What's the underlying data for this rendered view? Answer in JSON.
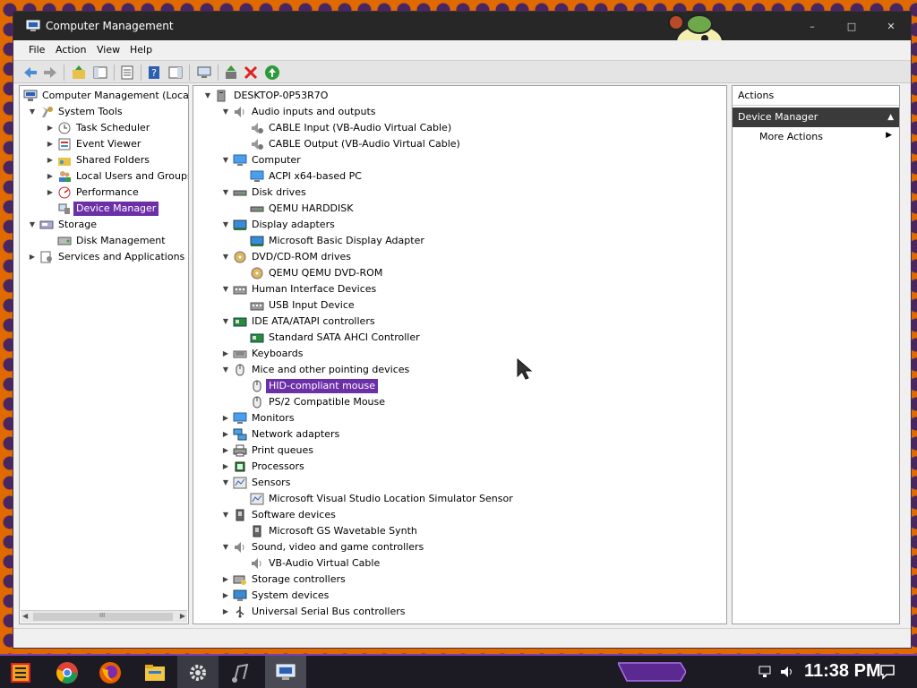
{
  "window": {
    "title": "Computer Management",
    "controls": {
      "minimize": "–",
      "maximize": "□",
      "close": "✕"
    }
  },
  "menu": [
    "File",
    "Action",
    "View",
    "Help"
  ],
  "left_tree": [
    {
      "label": "Computer Management (Local)",
      "icon": "computer-management-icon",
      "exp": ""
    },
    {
      "label": "System Tools",
      "icon": "system-tools-icon",
      "exp": "▼"
    },
    {
      "label": "Task Scheduler",
      "icon": "task-scheduler-icon",
      "exp": "▶"
    },
    {
      "label": "Event Viewer",
      "icon": "event-viewer-icon",
      "exp": "▶"
    },
    {
      "label": "Shared Folders",
      "icon": "shared-folders-icon",
      "exp": "▶"
    },
    {
      "label": "Local Users and Groups",
      "icon": "users-icon",
      "exp": "▶"
    },
    {
      "label": "Performance",
      "icon": "performance-icon",
      "exp": "▶"
    },
    {
      "label": "Device Manager",
      "icon": "device-manager-icon",
      "exp": "",
      "selected": true
    },
    {
      "label": "Storage",
      "icon": "storage-icon",
      "exp": "▼"
    },
    {
      "label": "Disk Management",
      "icon": "disk-management-icon",
      "exp": ""
    },
    {
      "label": "Services and Applications",
      "icon": "services-icon",
      "exp": "▶"
    }
  ],
  "device_tree": [
    {
      "label": "DESKTOP-0P53R7O",
      "icon": "computer-icon",
      "exp": "▼"
    },
    {
      "label": "Audio inputs and outputs",
      "icon": "speaker-icon",
      "exp": "▼"
    },
    {
      "label": "CABLE Input (VB-Audio Virtual Cable)",
      "icon": "audio-device-icon",
      "exp": ""
    },
    {
      "label": "CABLE Output (VB-Audio Virtual Cable)",
      "icon": "audio-device-icon",
      "exp": ""
    },
    {
      "label": "Computer",
      "icon": "monitor-icon",
      "exp": "▼"
    },
    {
      "label": "ACPI x64-based PC",
      "icon": "monitor-icon",
      "exp": ""
    },
    {
      "label": "Disk drives",
      "icon": "disk-icon",
      "exp": "▼"
    },
    {
      "label": "QEMU HARDDISK",
      "icon": "disk-icon",
      "exp": ""
    },
    {
      "label": "Display adapters",
      "icon": "display-adapter-icon",
      "exp": "▼"
    },
    {
      "label": "Microsoft Basic Display Adapter",
      "icon": "display-adapter-icon",
      "exp": ""
    },
    {
      "label": "DVD/CD-ROM drives",
      "icon": "dvd-icon",
      "exp": "▼"
    },
    {
      "label": "QEMU QEMU DVD-ROM",
      "icon": "dvd-icon",
      "exp": ""
    },
    {
      "label": "Human Interface Devices",
      "icon": "hid-icon",
      "exp": "▼"
    },
    {
      "label": "USB Input Device",
      "icon": "hid-icon",
      "exp": ""
    },
    {
      "label": "IDE ATA/ATAPI controllers",
      "icon": "controller-icon",
      "exp": "▼"
    },
    {
      "label": "Standard SATA AHCI Controller",
      "icon": "controller-icon",
      "exp": ""
    },
    {
      "label": "Keyboards",
      "icon": "keyboard-icon",
      "exp": "▶"
    },
    {
      "label": "Mice and other pointing devices",
      "icon": "mouse-icon",
      "exp": "▼"
    },
    {
      "label": "HID-compliant mouse",
      "icon": "mouse-icon",
      "exp": "",
      "selected": true
    },
    {
      "label": "PS/2 Compatible Mouse",
      "icon": "mouse-icon",
      "exp": ""
    },
    {
      "label": "Monitors",
      "icon": "monitor-icon",
      "exp": "▶"
    },
    {
      "label": "Network adapters",
      "icon": "network-icon",
      "exp": "▶"
    },
    {
      "label": "Print queues",
      "icon": "printer-icon",
      "exp": "▶"
    },
    {
      "label": "Processors",
      "icon": "processor-icon",
      "exp": "▶"
    },
    {
      "label": "Sensors",
      "icon": "sensor-icon",
      "exp": "▼"
    },
    {
      "label": "Microsoft Visual Studio Location Simulator Sensor",
      "icon": "sensor-icon",
      "exp": ""
    },
    {
      "label": "Software devices",
      "icon": "software-device-icon",
      "exp": "▼"
    },
    {
      "label": "Microsoft GS Wavetable Synth",
      "icon": "software-device-icon",
      "exp": ""
    },
    {
      "label": "Sound, video and game controllers",
      "icon": "speaker-icon",
      "exp": "▼"
    },
    {
      "label": "VB-Audio Virtual Cable",
      "icon": "speaker-icon",
      "exp": ""
    },
    {
      "label": "Storage controllers",
      "icon": "storage-controller-icon",
      "exp": "▶"
    },
    {
      "label": "System devices",
      "icon": "system-devices-icon",
      "exp": "▶"
    },
    {
      "label": "Universal Serial Bus controllers",
      "icon": "usb-icon",
      "exp": "▶"
    }
  ],
  "actions": {
    "title": "Actions",
    "header": "Device Manager",
    "header_caret": "▲",
    "more": "More Actions",
    "more_arrow": "▶"
  },
  "hscroll": {
    "left": "◀",
    "grip": "III",
    "right": "▶"
  },
  "taskbar": {
    "clock": "11:38 PM",
    "tray_icons": [
      "network-icon",
      "volume-icon",
      "notification-icon"
    ],
    "apps": [
      "start-icon",
      "chrome-icon",
      "firefox-icon",
      "file-explorer-icon",
      "settings-icon",
      "music-app-icon",
      "computer-management-icon"
    ]
  },
  "colors": {
    "selection": "#6b2fa8",
    "titlebar": "#272727",
    "taskbar_accent": "#7a3fb0",
    "desktop": "#e06a00"
  }
}
